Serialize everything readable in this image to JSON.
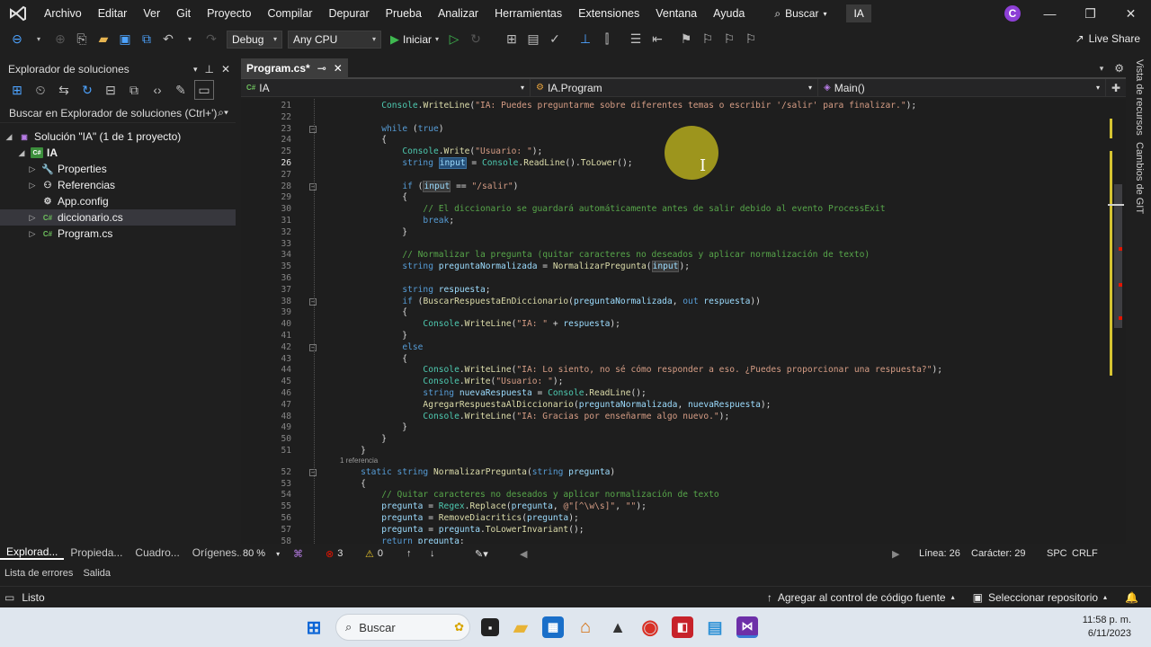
{
  "menu": {
    "items": [
      "Archivo",
      "Editar",
      "Ver",
      "Git",
      "Proyecto",
      "Compilar",
      "Depurar",
      "Prueba",
      "Analizar",
      "Herramientas",
      "Extensiones",
      "Ventana",
      "Ayuda"
    ],
    "search": "Buscar",
    "solution": "IA",
    "avatar": "C"
  },
  "toolbar": {
    "config": "Debug",
    "platform": "Any CPU",
    "start": "Iniciar",
    "live_share": "Live Share"
  },
  "solution_explorer": {
    "title": "Explorador de soluciones",
    "search": "Buscar en Explorador de soluciones (Ctrl+')",
    "tree": [
      {
        "label": "Solución \"IA\" (1 de 1 proyecto)",
        "icon": "solution-icon"
      },
      {
        "label": "IA",
        "icon": "csharp-project-icon"
      },
      {
        "label": "Properties",
        "icon": "wrench-icon"
      },
      {
        "label": "Referencias",
        "icon": "references-icon"
      },
      {
        "label": "App.config",
        "icon": "config-file-icon"
      },
      {
        "label": "diccionario.cs",
        "icon": "csharp-file-icon"
      },
      {
        "label": "Program.cs",
        "icon": "csharp-file-icon"
      }
    ],
    "tabs": [
      "Explorad...",
      "Propieda...",
      "Cuadro...",
      "Orígenes..."
    ]
  },
  "editor": {
    "tab": "Program.cs*",
    "nav_project": "IA",
    "nav_class": "IA.Program",
    "nav_member": "Main()",
    "reference_hint": "1 referencia",
    "lines": [
      {
        "n": "21",
        "t": "        Console.WriteLine(\"IA: Puedes preguntarme sobre diferentes temas o escribir '/salir' para finalizar.\");"
      },
      {
        "n": "22",
        "t": ""
      },
      {
        "n": "23",
        "t": "        while (true)"
      },
      {
        "n": "24",
        "t": "        {"
      },
      {
        "n": "25",
        "t": "            Console.Write(\"Usuario: \");"
      },
      {
        "n": "26",
        "t": "            string input = Console.ReadLine().ToLower();"
      },
      {
        "n": "27",
        "t": ""
      },
      {
        "n": "28",
        "t": "            if (input == \"/salir\")"
      },
      {
        "n": "29",
        "t": "            {"
      },
      {
        "n": "30",
        "t": "                // El diccionario se guardará automáticamente antes de salir debido al evento ProcessExit"
      },
      {
        "n": "31",
        "t": "                break;"
      },
      {
        "n": "32",
        "t": "            }"
      },
      {
        "n": "33",
        "t": ""
      },
      {
        "n": "34",
        "t": "            // Normalizar la pregunta (quitar caracteres no deseados y aplicar normalización de texto)"
      },
      {
        "n": "35",
        "t": "            string preguntaNormalizada = NormalizarPregunta(input);"
      },
      {
        "n": "36",
        "t": ""
      },
      {
        "n": "37",
        "t": "            string respuesta;"
      },
      {
        "n": "38",
        "t": "            if (BuscarRespuestaEnDiccionario(preguntaNormalizada, out respuesta))"
      },
      {
        "n": "39",
        "t": "            {"
      },
      {
        "n": "40",
        "t": "                Console.WriteLine(\"IA: \" + respuesta);"
      },
      {
        "n": "41",
        "t": "            }"
      },
      {
        "n": "42",
        "t": "            else"
      },
      {
        "n": "43",
        "t": "            {"
      },
      {
        "n": "44",
        "t": "                Console.WriteLine(\"IA: Lo siento, no sé cómo responder a eso. ¿Puedes proporcionar una respuesta?\");"
      },
      {
        "n": "45",
        "t": "                Console.Write(\"Usuario: \");"
      },
      {
        "n": "46",
        "t": "                string nuevaRespuesta = Console.ReadLine();"
      },
      {
        "n": "47",
        "t": "                AgregarRespuestaAlDiccionario(preguntaNormalizada, nuevaRespuesta);"
      },
      {
        "n": "48",
        "t": "                Console.WriteLine(\"IA: Gracias por enseñarme algo nuevo.\");"
      },
      {
        "n": "49",
        "t": "            }"
      },
      {
        "n": "50",
        "t": "        }"
      },
      {
        "n": "51",
        "t": "    }"
      },
      {
        "n": "52",
        "t": "    static string NormalizarPregunta(string pregunta)"
      },
      {
        "n": "53",
        "t": "    {"
      },
      {
        "n": "54",
        "t": "        // Quitar caracteres no deseados y aplicar normalización de texto"
      },
      {
        "n": "55",
        "t": "        pregunta = Regex.Replace(pregunta, @\"[^\\w\\s]\", \"\");"
      },
      {
        "n": "56",
        "t": "        pregunta = RemoveDiacritics(pregunta);"
      },
      {
        "n": "57",
        "t": "        pregunta = pregunta.ToLowerInvariant();"
      },
      {
        "n": "58",
        "t": "        return pregunta;"
      }
    ],
    "status": {
      "zoom": "80 %",
      "errors": "3",
      "warnings": "0",
      "line": "Línea: 26",
      "char": "Carácter: 29",
      "encoding": "SPC",
      "eol": "CRLF"
    }
  },
  "side_panel": [
    "Vista de recursos",
    "Cambios de GIT"
  ],
  "output_tabs": [
    "Lista de errores",
    "Salida"
  ],
  "statusbar": {
    "ready": "Listo",
    "source_control": "Agregar al control de código fuente",
    "repo": "Seleccionar repositorio"
  },
  "taskbar": {
    "search": "Buscar",
    "time": "11:58 p. m.",
    "date": "6/11/2023"
  }
}
